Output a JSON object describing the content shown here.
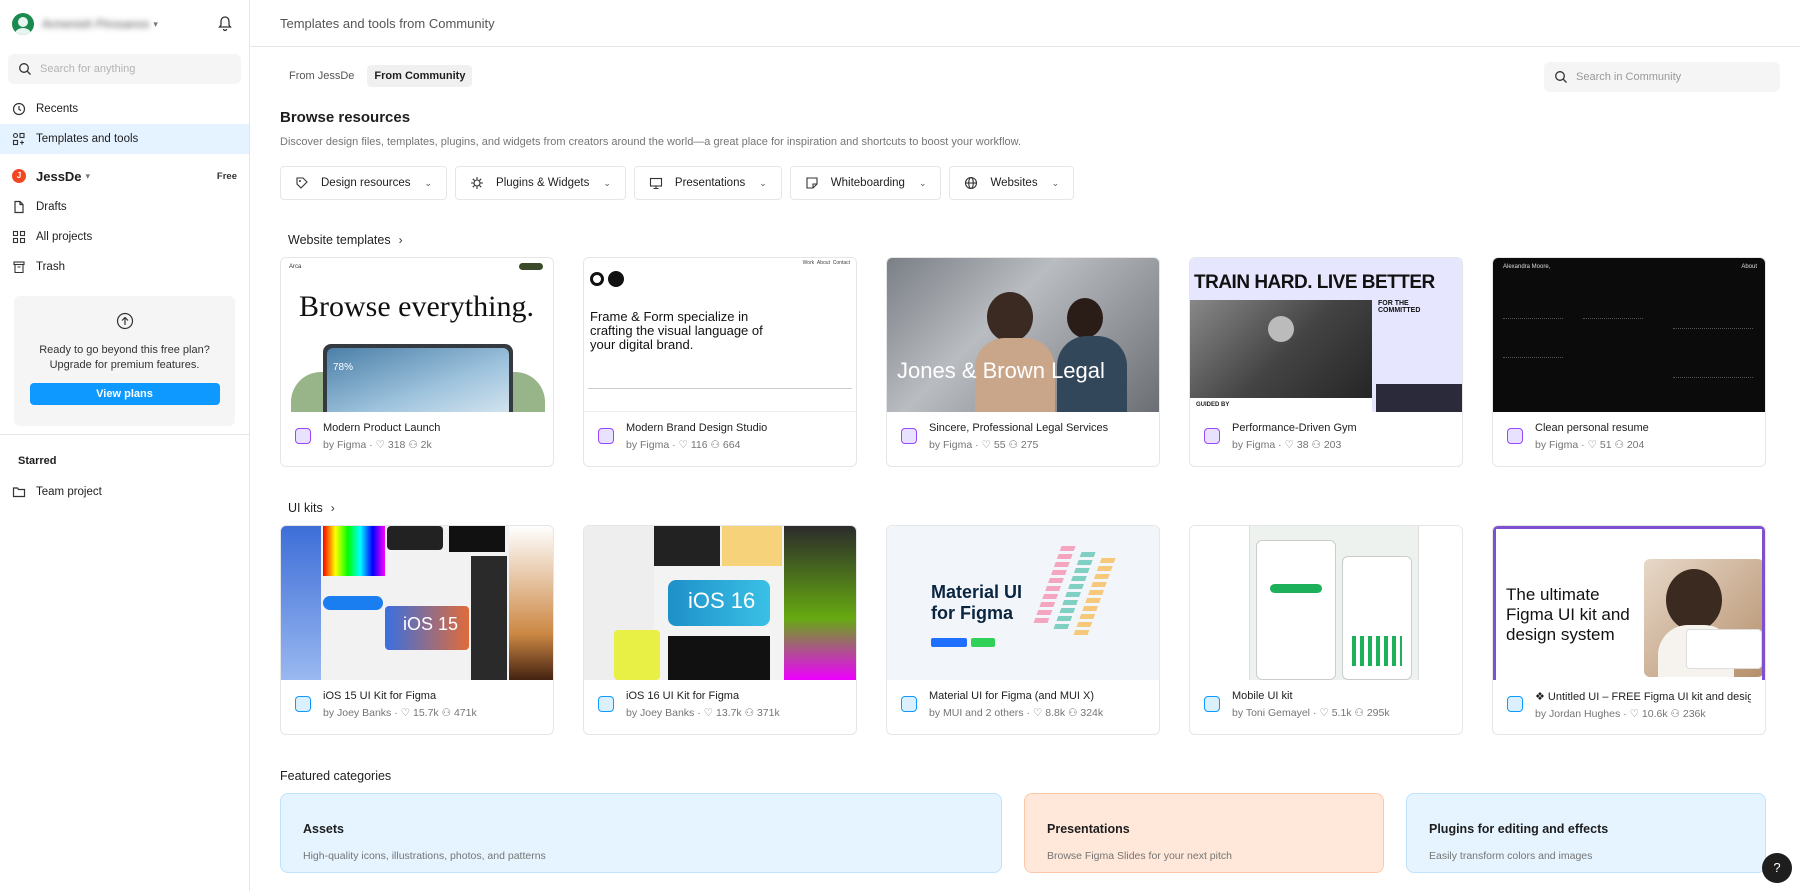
{
  "sidebar": {
    "account_name": "Armenish Pirosanos",
    "search_placeholder": "Search for anything",
    "nav": [
      {
        "label": "Recents",
        "icon": "clock-icon"
      },
      {
        "label": "Templates and tools",
        "icon": "templates-icon"
      }
    ],
    "team": {
      "initial": "J",
      "name": "JessDe",
      "plan": "Free"
    },
    "team_nav": [
      {
        "label": "Drafts",
        "icon": "file-icon"
      },
      {
        "label": "All projects",
        "icon": "grid-icon"
      },
      {
        "label": "Trash",
        "icon": "trash-icon"
      }
    ],
    "upgrade": {
      "text1": "Ready to go beyond this free plan?",
      "text2": "Upgrade for premium features.",
      "button": "View plans"
    },
    "starred": {
      "heading": "Starred",
      "item": "Team project"
    }
  },
  "main": {
    "page_title": "Templates and tools from Community",
    "tabs": [
      {
        "label": "From JessDe",
        "active": false
      },
      {
        "label": "From Community",
        "active": true
      }
    ],
    "community_search_placeholder": "Search in Community",
    "browse_heading": "Browse resources",
    "browse_sub": "Discover design files, templates, plugins, and widgets from creators around the world—a great place for inspiration and shortcuts to boost your workflow.",
    "filters": [
      "Design resources",
      "Plugins & Widgets",
      "Presentations",
      "Whiteboarding",
      "Websites"
    ],
    "website_section": "Website templates",
    "website_cards": [
      {
        "title": "Modern Product Launch",
        "by": "by Figma",
        "likes": "318",
        "users": "2k",
        "thumb_text": "Browse everything."
      },
      {
        "title": "Modern Brand Design Studio",
        "by": "by Figma",
        "likes": "116",
        "users": "664",
        "thumb_text": "Frame & Form specialize in crafting the visual language of your digital brand."
      },
      {
        "title": "Sincere, Professional Legal Services",
        "by": "by Figma",
        "likes": "55",
        "users": "275",
        "thumb_text": "Jones & Brown Legal"
      },
      {
        "title": "Performance-Driven Gym",
        "by": "by Figma",
        "likes": "38",
        "users": "203",
        "thumb_text": "TRAIN HARD. LIVE BETTER"
      },
      {
        "title": "Clean personal resume",
        "by": "by Figma",
        "likes": "51",
        "users": "204",
        "thumb_text": "Alexandra Moore,"
      }
    ],
    "uikit_section": "UI kits",
    "uikit_cards": [
      {
        "title": "iOS 15 UI Kit for Figma",
        "by": "by Joey Banks",
        "likes": "15.7k",
        "users": "471k",
        "thumb_text": "iOS 15"
      },
      {
        "title": "iOS 16 UI Kit for Figma",
        "by": "by Joey Banks",
        "likes": "13.7k",
        "users": "371k",
        "thumb_text": "iOS 16"
      },
      {
        "title": "Material UI for Figma (and MUI X)",
        "by": "by MUI and 2 others",
        "likes": "8.8k",
        "users": "324k",
        "thumb_text": "Material UI for Figma"
      },
      {
        "title": "Mobile UI kit",
        "by": "by Toni Gemayel",
        "likes": "5.1k",
        "users": "295k",
        "thumb_text": ""
      },
      {
        "title": "❖ Untitled UI – FREE Figma UI kit and desig",
        "by": "by Jordan Hughes",
        "likes": "10.6k",
        "users": "236k",
        "thumb_text": "The ultimate Figma UI kit and design system"
      }
    ],
    "featured_heading": "Featured categories",
    "featured": [
      {
        "title": "Assets",
        "sub": "High-quality icons, illustrations, photos, and patterns",
        "color": "#e5f4ff"
      },
      {
        "title": "Presentations",
        "sub": "Browse Figma Slides for your next pitch",
        "color": "#ffe8d9"
      },
      {
        "title": "Plugins for editing and effects",
        "sub": "Easily transform colors and images",
        "color": "#e5f4ff"
      }
    ]
  }
}
